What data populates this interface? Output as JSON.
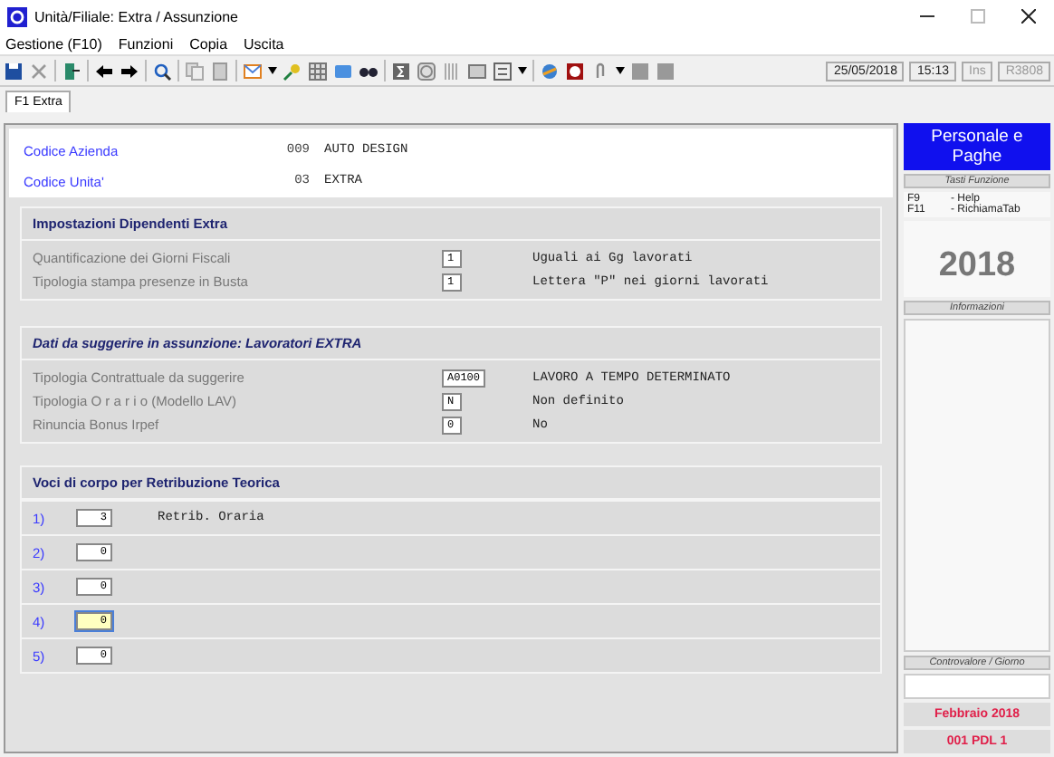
{
  "window": {
    "title": "Unità/Filiale: Extra / Assunzione"
  },
  "menu": [
    "Gestione (F10)",
    "Funzioni",
    "Copia",
    "Uscita"
  ],
  "status_fields": [
    {
      "text": "25/05/2018",
      "disabled": false
    },
    {
      "text": "15:13",
      "disabled": false
    },
    {
      "text": "Ins",
      "disabled": true
    },
    {
      "text": "R3808",
      "disabled": true
    }
  ],
  "tabs": [
    {
      "label": "F1 Extra",
      "selected": true
    }
  ],
  "header": [
    {
      "label": "Codice Azienda",
      "code": "009",
      "value": "AUTO DESIGN"
    },
    {
      "label": "Codice Unita'",
      "code": "03",
      "value": "EXTRA"
    }
  ],
  "sections": [
    {
      "title": "Impostazioni Dipendenti  Extra",
      "italic": false,
      "fields": [
        {
          "label": "Quantificazione  dei  Giorni Fiscali",
          "value": "1",
          "description": "Uguali ai Gg lavorati"
        },
        {
          "label": "Tipologia  stampa  presenze in Busta",
          "value": "1",
          "description": "Lettera \"P\" nei giorni lavorati"
        }
      ]
    },
    {
      "title": "Dati da suggerire in assunzione: Lavoratori EXTRA",
      "italic": true,
      "fields": [
        {
          "label": "Tipologia Contrattuale  da suggerire",
          "value": "A0100",
          "description": "LAVORO A TEMPO DETERMINATO"
        },
        {
          "label": "Tipologia O r a r i o  (Modello LAV)",
          "value": "N",
          "description": "Non definito"
        },
        {
          "label": "Rinuncia Bonus Irpef",
          "value": "0",
          "description": "No"
        }
      ]
    }
  ],
  "voci": {
    "title": "Voci di corpo per Retribuzione Teorica",
    "rows": [
      {
        "index": "1)",
        "value": "3",
        "description": "Retrib. Oraria",
        "focused": false
      },
      {
        "index": "2)",
        "value": "0",
        "focused": false
      },
      {
        "index": "3)",
        "value": "0",
        "focused": false
      },
      {
        "index": "4)",
        "value": "0",
        "focused": true
      },
      {
        "index": "5)",
        "value": "0",
        "focused": false
      }
    ]
  },
  "side_panel": {
    "brand": "Personale e Paghe",
    "keys_title": "Tasti Funzione",
    "keys": [
      {
        "key": "F9",
        "action": "- Help"
      },
      {
        "key": "F11",
        "action": "- RichiamaTab"
      }
    ],
    "year": "2018",
    "info_title": "Informazioni",
    "controller_title": "Controvalore / Giorno",
    "period": "Febbraio  2018",
    "company": "001 PDL 1"
  }
}
